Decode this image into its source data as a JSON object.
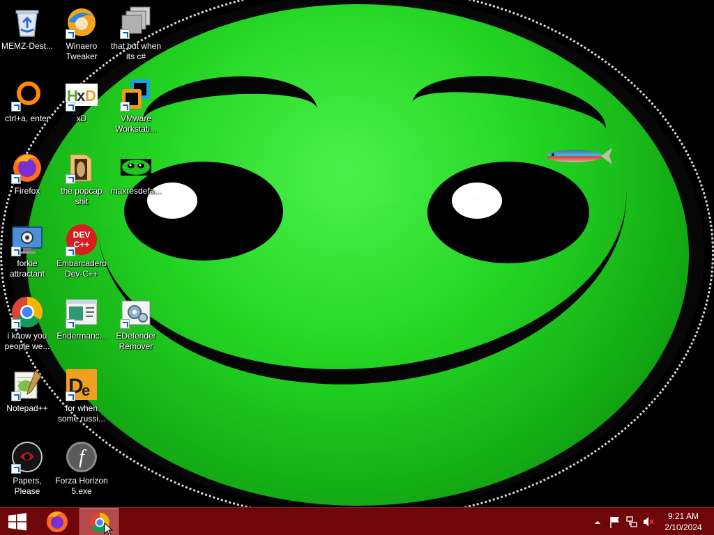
{
  "desktop": {
    "icons": [
      {
        "label": "MEMZ-Dest...",
        "icon": "recycle-bin-icon"
      },
      {
        "label": "Winaero Tweaker",
        "icon": "winaero-icon"
      },
      {
        "label": "that but when its c#",
        "icon": "stacked-windows-icon"
      },
      {
        "label": "ctrl+a, enter",
        "icon": "ring-icon"
      },
      {
        "label": "xD",
        "icon": "hxd-icon"
      },
      {
        "label": "VMware Workstati...",
        "icon": "vmware-icon"
      },
      {
        "label": "Firefox",
        "icon": "firefox-icon"
      },
      {
        "label": "the popcap shit",
        "icon": "folder-icon"
      },
      {
        "label": "maxresdefa...",
        "icon": "green-face-thumbnail-icon"
      },
      {
        "label": "forkie attractant",
        "icon": "settings-monitor-icon"
      },
      {
        "label": "Embarcadero Dev-C++",
        "icon": "devcpp-icon"
      },
      {
        "label": "i know you people we...",
        "icon": "chrome-icon"
      },
      {
        "label": "Endermanc...",
        "icon": "window-app-icon"
      },
      {
        "label": "EDefender Remover",
        "icon": "gear-window-icon"
      },
      {
        "label": "Notepad++",
        "icon": "notepadpp-icon"
      },
      {
        "label": "for when some russi...",
        "icon": "de-icon"
      },
      {
        "label": "Papers, Please",
        "icon": "papers-please-icon"
      },
      {
        "label": "Forza Horizon 5.exe",
        "icon": "flash-icon"
      }
    ]
  },
  "taskbar": {
    "start_icon": "windows-start-icon",
    "pinned": [
      {
        "name": "Firefox",
        "icon": "firefox-icon"
      },
      {
        "name": "Google Chrome",
        "icon": "chrome-icon",
        "active": true
      }
    ],
    "tray": {
      "icons": [
        "chevron-up-icon",
        "flag-icon",
        "network-icon",
        "volume-muted-icon"
      ]
    },
    "clock": {
      "time": "9:21 AM",
      "date": "2/10/2024"
    },
    "colors": {
      "background": "#6e060a",
      "active": "#b54a4a"
    }
  },
  "wallpaper": {
    "description_icon": "green-smiley-wallpaper",
    "colors": {
      "face": "#23d423",
      "background": "#000000"
    }
  }
}
